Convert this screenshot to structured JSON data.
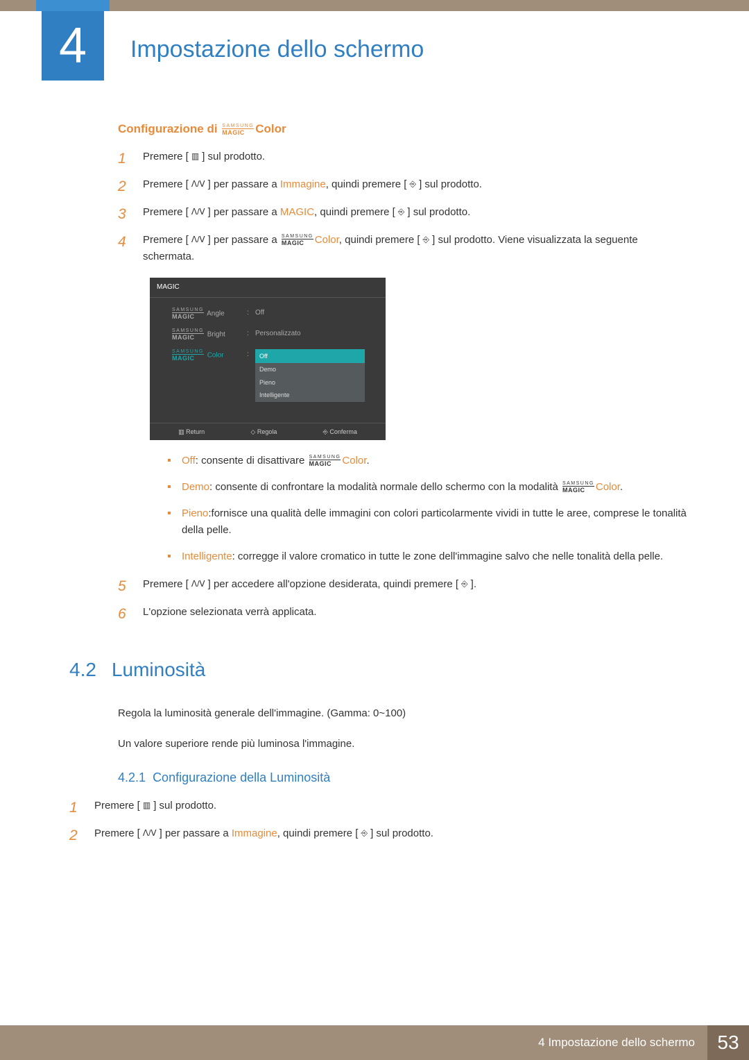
{
  "chapter": {
    "number": "4",
    "title": "Impostazione dello schermo"
  },
  "subheading": {
    "prefix": "Configurazione di",
    "suffix": "Color"
  },
  "magic_logo": {
    "top": "SAMSUNG",
    "bottom": "MAGIC"
  },
  "icons": {
    "menu": "▥",
    "updown": "ᐱ/ᐯ",
    "enter": "⎆",
    "confirm": "⎆",
    "adjust": "◇"
  },
  "steps_a": [
    {
      "pre": "Premere [",
      "icon": "menu",
      "post": "] sul prodotto."
    },
    {
      "pre": "Premere [",
      "icon": "updown",
      "mid": "] per passare a ",
      "hl": "Immagine",
      "mid2": ", quindi premere [",
      "icon2": "enter",
      "post": "] sul prodotto."
    },
    {
      "pre": "Premere [",
      "icon": "updown",
      "mid": "] per passare a ",
      "hl": "MAGIC",
      "mid2": ", quindi premere [",
      "icon2": "enter",
      "post": "] sul prodotto."
    },
    {
      "pre": "Premere [",
      "icon": "updown",
      "mid": "] per passare a ",
      "magic_suffix": "Color",
      "mid2": ", quindi premere [",
      "icon2": "enter",
      "post": "] sul prodotto. Viene visualizzata la seguente schermata."
    }
  ],
  "screenshot": {
    "title": "MAGIC",
    "rows": [
      {
        "label_suffix": "Angle",
        "value": "Off"
      },
      {
        "label_suffix": "Bright",
        "value": "Personalizzato"
      },
      {
        "label_suffix": "Color",
        "dropdown": [
          "Off",
          "Demo",
          "Pieno",
          "Intelligente"
        ],
        "selected": 0
      }
    ],
    "footer": {
      "return": "Return",
      "adjust": "Regola",
      "confirm": "Conferma"
    }
  },
  "options": [
    {
      "name": "Off",
      "text_pre": ": consente di disattivare ",
      "has_logo_after": true,
      "logo_suffix": "Color",
      "text_post": "."
    },
    {
      "name": "Demo",
      "text_pre": ": consente di confrontare la modalità normale dello schermo con la modalità ",
      "has_logo_after": true,
      "logo_suffix": "Color",
      "text_post": "."
    },
    {
      "name": "Pieno",
      "text_pre": ":fornisce una qualità delle immagini con colori particolarmente vividi in tutte le aree, comprese le tonalità della pelle."
    },
    {
      "name": "Intelligente",
      "text_pre": ": corregge il valore cromatico in tutte le zone dell'immagine salvo che nelle tonalità della pelle."
    }
  ],
  "steps_b": [
    {
      "num": "5",
      "pre": "Premere [",
      "icon": "updown",
      "mid": "] per accedere all'opzione desiderata, quindi premere [",
      "icon2": "enter",
      "post": "]."
    },
    {
      "num": "6",
      "text": "L'opzione selezionata verrà applicata."
    }
  ],
  "section42": {
    "num": "4.2",
    "title": "Luminosità",
    "p1": "Regola la luminosità generale dell'immagine. (Gamma: 0~100)",
    "p2": "Un valore superiore rende più luminosa l'immagine.",
    "sub": {
      "num": "4.2.1",
      "title": "Configurazione della Luminosità"
    },
    "steps": [
      {
        "pre": "Premere [",
        "icon": "menu",
        "post": "] sul prodotto."
      },
      {
        "pre": "Premere [",
        "icon": "updown",
        "mid": "] per passare a ",
        "hl": "Immagine",
        "mid2": ", quindi premere [",
        "icon2": "enter",
        "post": "] sul prodotto."
      }
    ]
  },
  "footer": {
    "text": "4 Impostazione dello schermo",
    "page": "53"
  }
}
